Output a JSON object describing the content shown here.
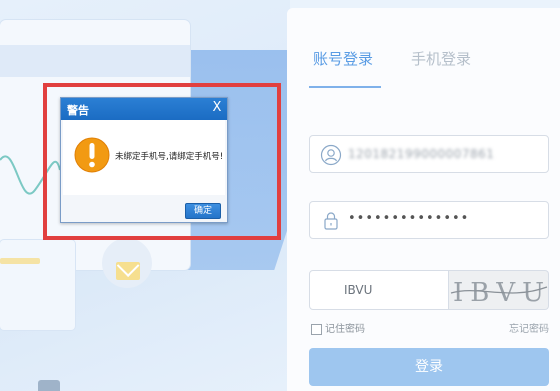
{
  "login": {
    "tab_account": "账号登录",
    "tab_phone": "手机登录",
    "username_value": "120182199000007861",
    "password_value": "••••••••••••••",
    "captcha_value": "IBVU",
    "captcha_image_text": "IBVU",
    "remember_label": "记住密码",
    "forgot_label": "忘记密码",
    "login_button": "登录"
  },
  "dialog": {
    "title": "警告",
    "close": "X",
    "message": "未绑定手机号,请绑定手机号!",
    "ok_button": "确定"
  },
  "colors": {
    "accent": "#5a9ce4",
    "highlight_frame": "#e13f3f",
    "dialog_title_bg": "#1b6cc3",
    "warning_icon": "#f29a12"
  }
}
